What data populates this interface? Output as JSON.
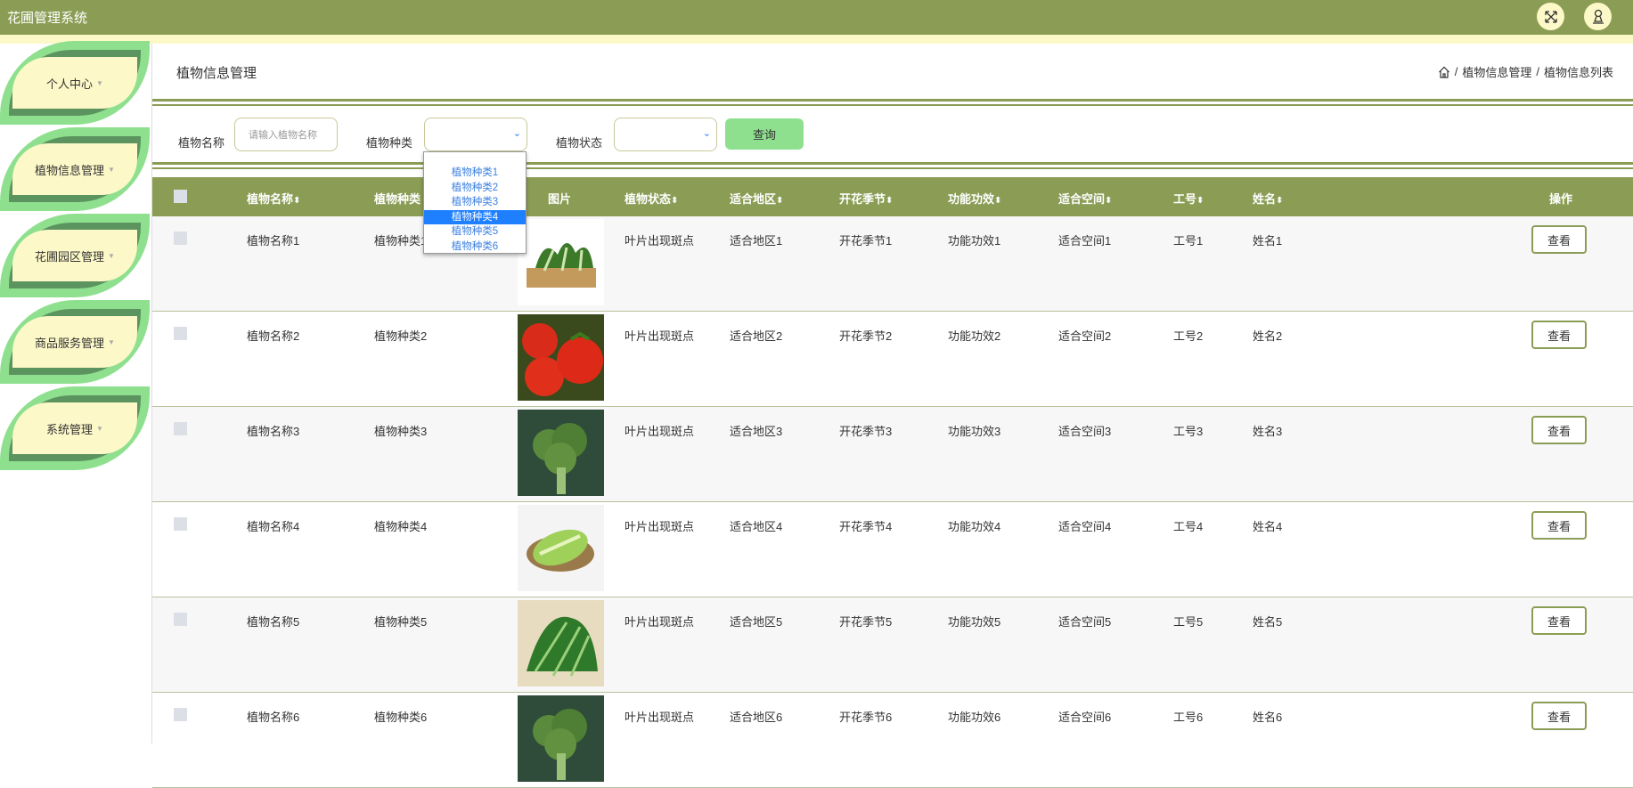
{
  "app": {
    "title": "花圃管理系统"
  },
  "header_icons": [
    "fullscreen-icon",
    "user-icon"
  ],
  "sidebar": {
    "items": [
      {
        "label": "个人中心"
      },
      {
        "label": "植物信息管理"
      },
      {
        "label": "花圃园区管理"
      },
      {
        "label": "商品服务管理"
      },
      {
        "label": "系统管理"
      }
    ]
  },
  "page": {
    "title": "植物信息管理",
    "breadcrumb": [
      "植物信息管理",
      "植物信息列表"
    ],
    "separator": "/"
  },
  "filter": {
    "name_label": "植物名称",
    "name_placeholder": "请输入植物名称",
    "type_label": "植物种类",
    "status_label": "植物状态",
    "query_label": "查询",
    "type_options": [
      "植物种类1",
      "植物种类2",
      "植物种类3",
      "植物种类4",
      "植物种类5",
      "植物种类6"
    ],
    "type_highlighted": "植物种类4"
  },
  "table": {
    "headers": [
      "植物名称",
      "植物种类",
      "图片",
      "植物状态",
      "适合地区",
      "开花季节",
      "功能功效",
      "适合空间",
      "工号",
      "姓名",
      "操作"
    ],
    "sort_icon": "⬍",
    "view_label": "查看",
    "rows": [
      {
        "name": "植物名称1",
        "type": "植物种类1",
        "status": "叶片出现斑点",
        "region": "适合地区1",
        "season": "开花季节1",
        "effect": "功能功效1",
        "space": "适合空间1",
        "id": "工号1",
        "person": "姓名1",
        "img": "bok-choy"
      },
      {
        "name": "植物名称2",
        "type": "植物种类2",
        "status": "叶片出现斑点",
        "region": "适合地区2",
        "season": "开花季节2",
        "effect": "功能功效2",
        "space": "适合空间2",
        "id": "工号2",
        "person": "姓名2",
        "img": "tomato"
      },
      {
        "name": "植物名称3",
        "type": "植物种类3",
        "status": "叶片出现斑点",
        "region": "适合地区3",
        "season": "开花季节3",
        "effect": "功能功效3",
        "space": "适合空间3",
        "id": "工号3",
        "person": "姓名3",
        "img": "broccoli"
      },
      {
        "name": "植物名称4",
        "type": "植物种类4",
        "status": "叶片出现斑点",
        "region": "适合地区4",
        "season": "开花季节4",
        "effect": "功能功效4",
        "space": "适合空间4",
        "id": "工号4",
        "person": "姓名4",
        "img": "lettuce"
      },
      {
        "name": "植物名称5",
        "type": "植物种类5",
        "status": "叶片出现斑点",
        "region": "适合地区5",
        "season": "开花季节5",
        "effect": "功能功效5",
        "space": "适合空间5",
        "id": "工号5",
        "person": "姓名5",
        "img": "greens"
      },
      {
        "name": "植物名称6",
        "type": "植物种类6",
        "status": "叶片出现斑点",
        "region": "适合地区6",
        "season": "开花季节6",
        "effect": "功能功效6",
        "space": "适合空间6",
        "id": "工号6",
        "person": "姓名6",
        "img": "broccoli"
      }
    ]
  }
}
